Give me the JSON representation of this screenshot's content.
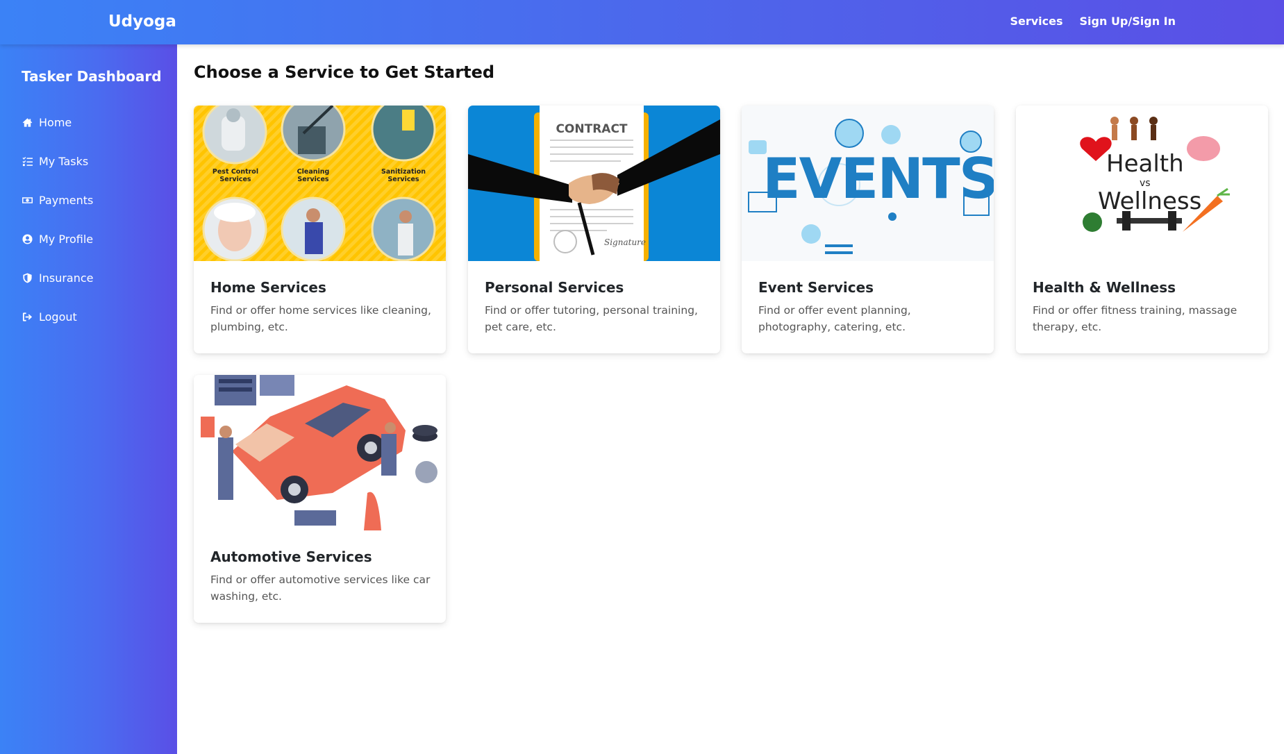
{
  "header": {
    "brand": "Udyoga",
    "nav": [
      {
        "label": "Services"
      },
      {
        "label": "Sign Up/Sign In"
      }
    ]
  },
  "sidebar": {
    "title": "Tasker Dashboard",
    "items": [
      {
        "label": "Home",
        "icon": "home-icon"
      },
      {
        "label": "My Tasks",
        "icon": "tasks-icon"
      },
      {
        "label": "Payments",
        "icon": "money-icon"
      },
      {
        "label": "My Profile",
        "icon": "user-circle-icon"
      },
      {
        "label": "Insurance",
        "icon": "shield-icon"
      },
      {
        "label": "Logout",
        "icon": "logout-icon"
      }
    ]
  },
  "main": {
    "title": "Choose a Service to Get Started",
    "cards": [
      {
        "title": "Home Services",
        "description": "Find or offer home services like cleaning, plumbing, etc.",
        "image": {
          "labels": [
            "Pest Control Services",
            "Cleaning Services",
            "Sanitization Services"
          ]
        }
      },
      {
        "title": "Personal Services",
        "description": "Find or offer tutoring, personal training, pet care, etc.",
        "image": {
          "labels": [
            "CONTRACT",
            "Signature"
          ]
        }
      },
      {
        "title": "Event Services",
        "description": "Find or offer event planning, photography, catering, etc.",
        "image": {
          "labels": [
            "EVENTS"
          ]
        }
      },
      {
        "title": "Health & Wellness",
        "description": "Find or offer fitness training, massage therapy, etc.",
        "image": {
          "labels": [
            "Health",
            "vs",
            "Wellness"
          ]
        }
      },
      {
        "title": "Automotive Services",
        "description": "Find or offer automotive services like car washing, etc.",
        "image": {
          "labels": []
        }
      }
    ]
  },
  "colors": {
    "gradient_start": "#3b82f6",
    "gradient_end": "#5a4fe6",
    "home_card_bg": "#ffc400",
    "contract_bg": "#0b86d6",
    "events_blue": "#1f7fc4",
    "car_color": "#ef6c55"
  }
}
